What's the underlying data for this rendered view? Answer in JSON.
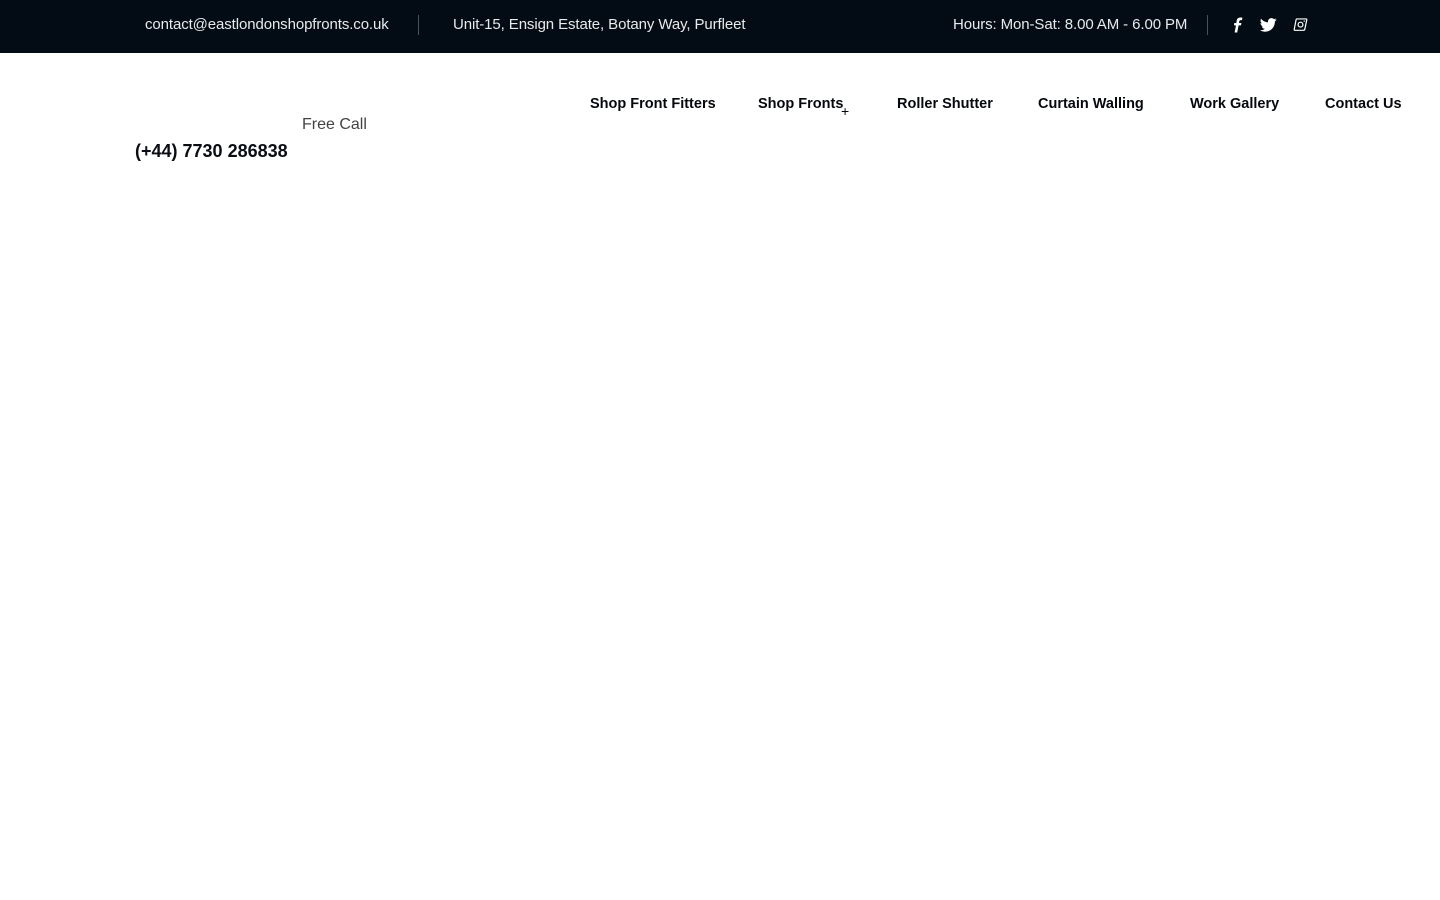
{
  "topbar": {
    "email": "contact@eastlondonshopfronts.co.uk",
    "address": "Unit-15, Ensign Estate, Botany Way, Purfleet",
    "hours": "Hours: Mon-Sat: 8.00 AM - 6.00 PM",
    "social": [
      {
        "name": "facebook",
        "icon": "facebook-icon"
      },
      {
        "name": "twitter",
        "icon": "twitter-icon"
      },
      {
        "name": "instagram",
        "icon": "instagram-icon"
      }
    ],
    "background_color": "#030c14",
    "text_color": "#e8eaec"
  },
  "header": {
    "free_call_label": "Free Call",
    "phone": "(+44) 7730 286838"
  },
  "nav": {
    "items": [
      {
        "label": "Shop Front Fitters",
        "has_submenu": false
      },
      {
        "label": "Shop Fronts",
        "has_submenu": true,
        "submenu_indicator": "+"
      },
      {
        "label": "Roller Shutter",
        "has_submenu": false
      },
      {
        "label": "Curtain Walling",
        "has_submenu": false
      },
      {
        "label": "Work Gallery",
        "has_submenu": false
      },
      {
        "label": "Contact Us",
        "has_submenu": false
      }
    ]
  }
}
